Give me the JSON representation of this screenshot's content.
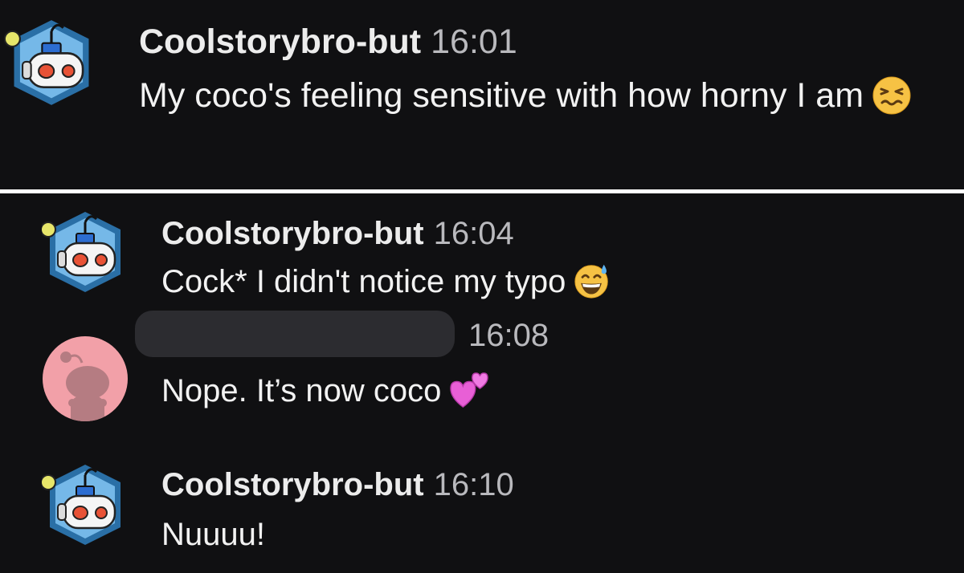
{
  "colors": {
    "background": "#101012",
    "divider": "#ffffff",
    "username": "#ececec",
    "timestamp": "#b9b9bd",
    "message_text": "#f2f2f2",
    "redaction": "#2c2c30",
    "bot_avatar_hex": "#2a6fa6",
    "bot_avatar_light": "#75b8e8",
    "default_avatar_bg": "#f2a0a8"
  },
  "first_screenshot": {
    "message": {
      "avatar_icon": "robot-snoo-avatar",
      "username": "Coolstorybro-but",
      "time": "16:01",
      "text": "My coco's feeling sensitive with how horny I am",
      "emoji_icon": "confounded-face-emoji"
    }
  },
  "second_screenshot": {
    "messages": [
      {
        "avatar_icon": "robot-snoo-avatar",
        "username": "Coolstorybro-but",
        "time": "16:04",
        "text": "Cock* I didn't notice my typo",
        "emoji_icon": "grinning-sweat-emoji"
      },
      {
        "avatar_icon": "default-snoo-avatar",
        "username_redacted": true,
        "time": "16:08",
        "text": "Nope. It’s now coco",
        "emoji_icon": "two-hearts-emoji"
      },
      {
        "avatar_icon": "robot-snoo-avatar",
        "username": "Coolstorybro-but",
        "time": "16:10",
        "text": "Nuuuu!"
      }
    ]
  }
}
